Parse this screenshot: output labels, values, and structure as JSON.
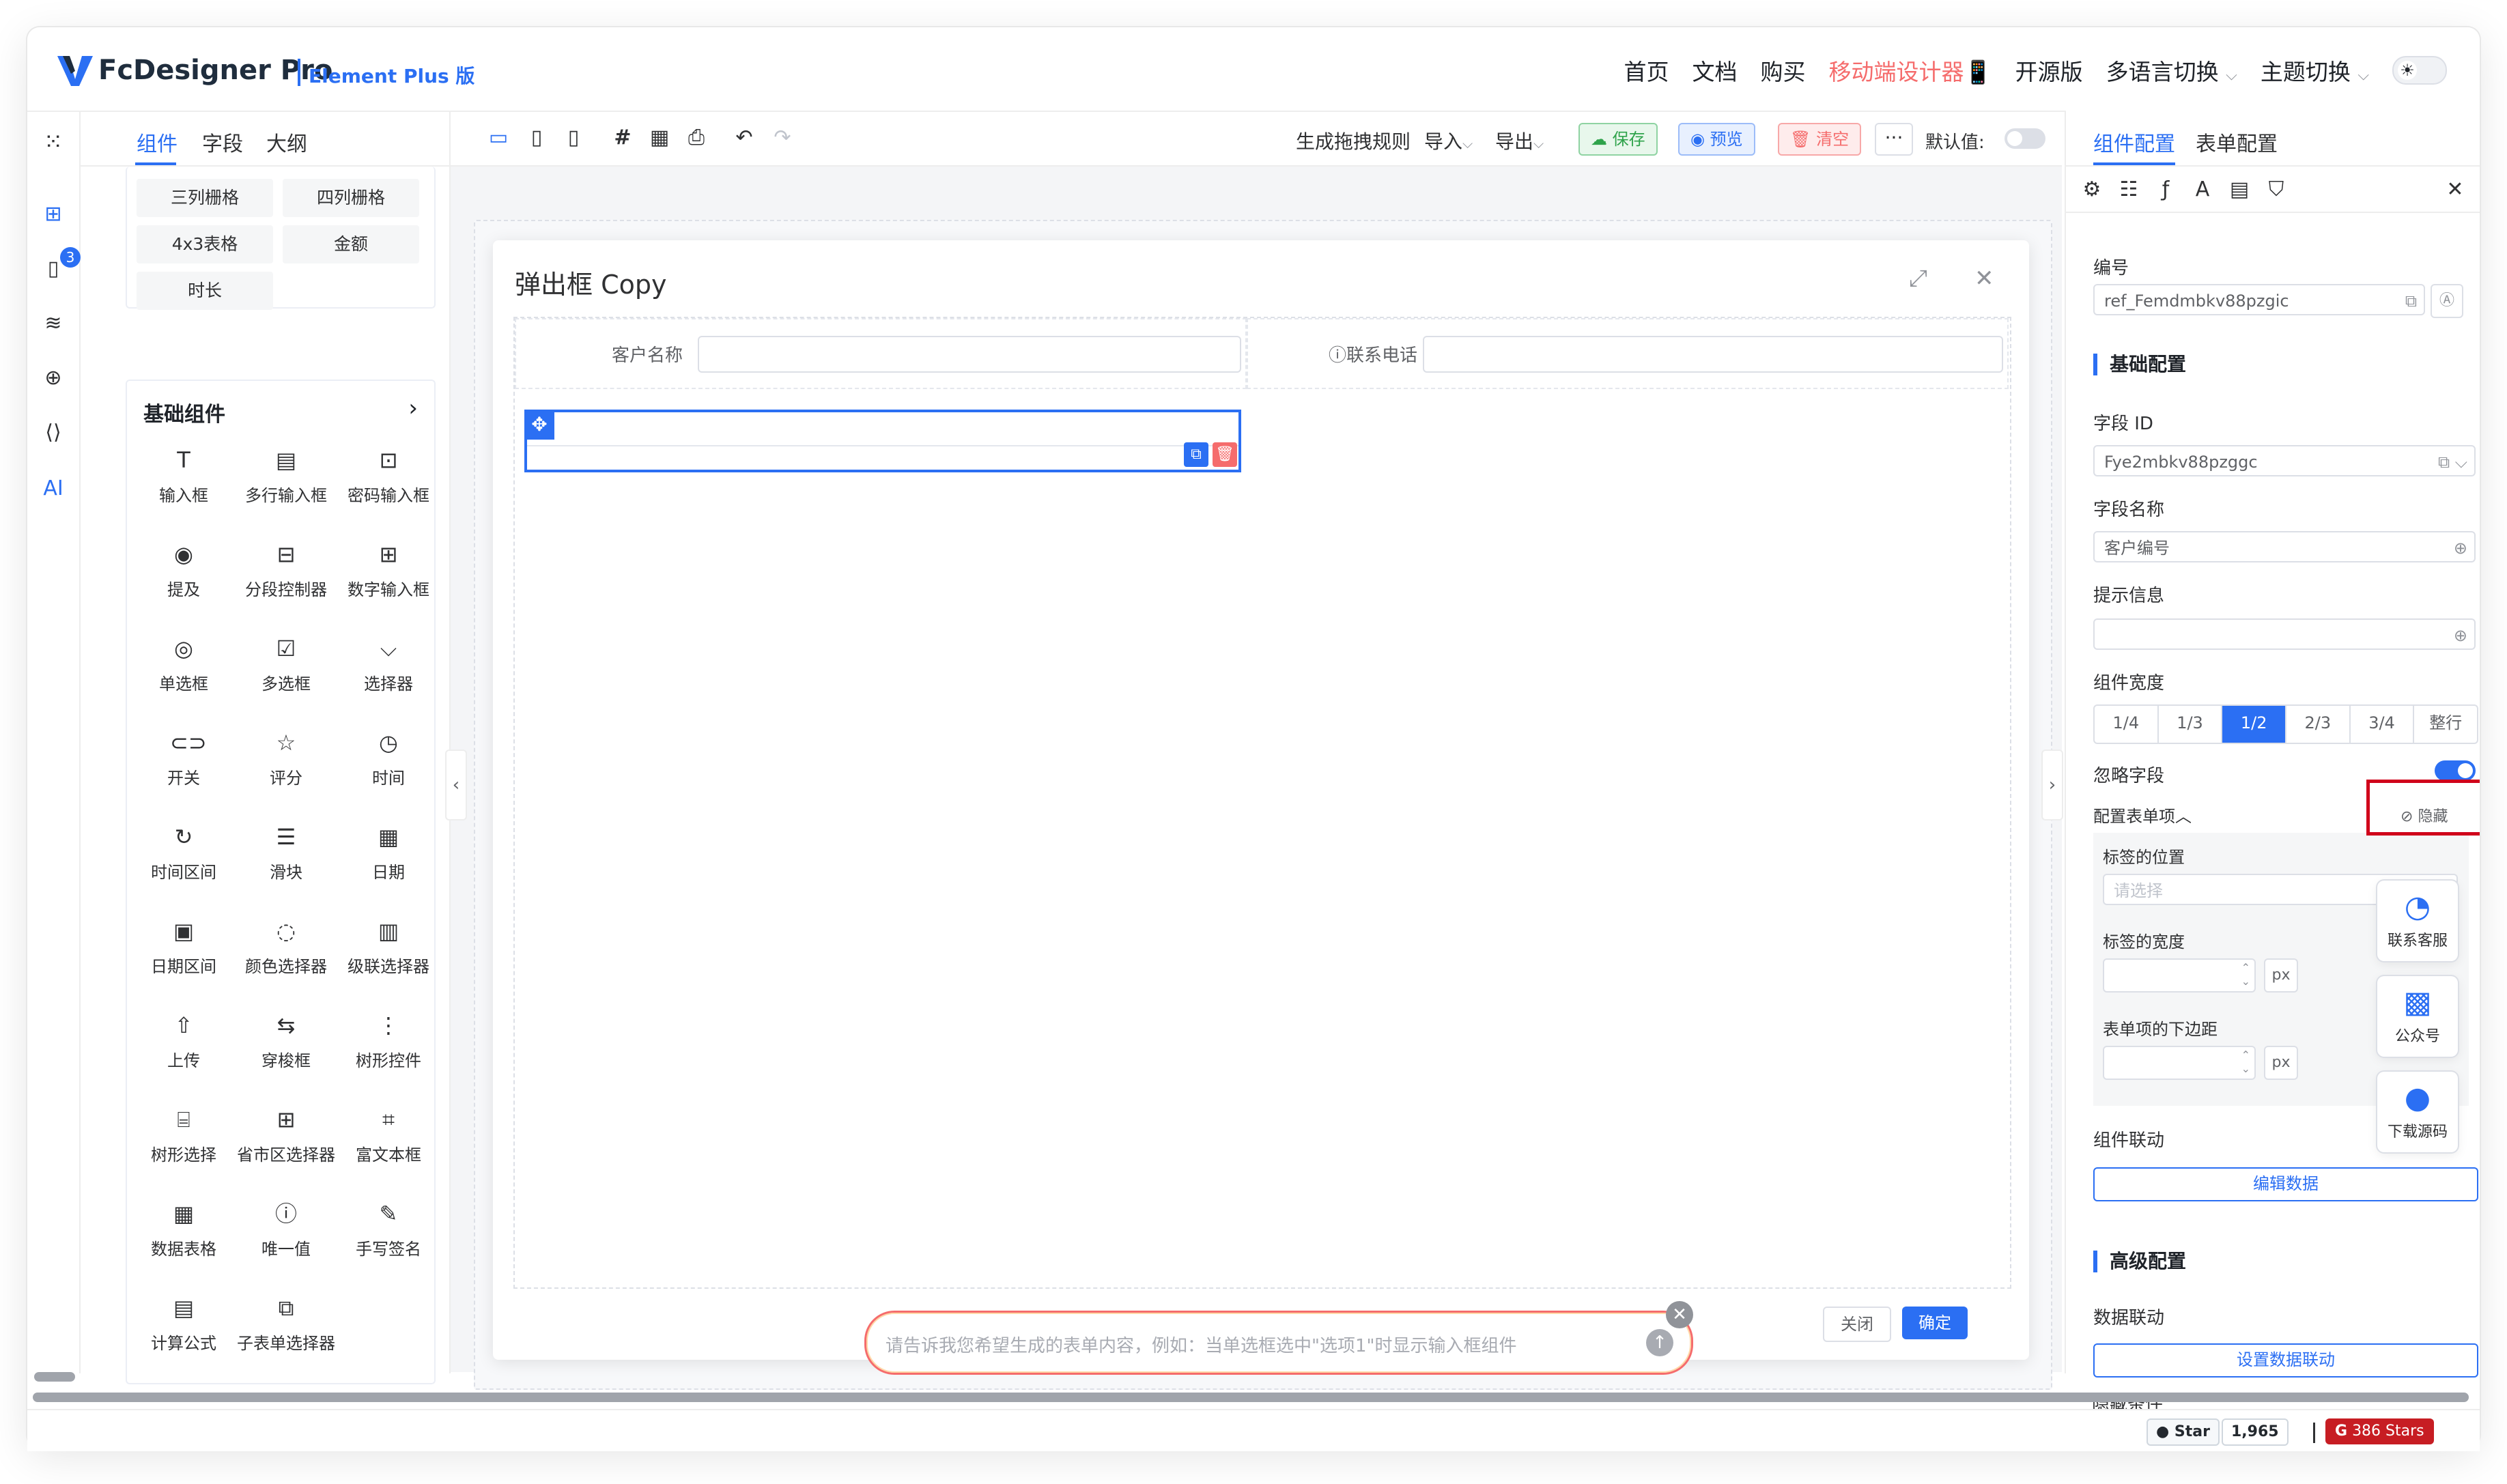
{
  "brand": {
    "name": "FcDesigner Pro",
    "edition": "Element Plus 版"
  },
  "topnav": {
    "home": "首页",
    "docs": "文档",
    "buy": "购买",
    "mobile": "移动端设计器📱",
    "open": "开源版",
    "lang": "多语言切换",
    "theme": "主题切换",
    "theme_icon": "☀"
  },
  "rail": {
    "badge": "3",
    "ai": "AI"
  },
  "left": {
    "tabs": [
      "组件",
      "字段",
      "大纲"
    ],
    "layout_chips": [
      "三列栅格",
      "四列栅格",
      "4x3表格",
      "金额",
      "时长"
    ],
    "group_title": "基础组件",
    "components": [
      {
        "label": "输入框",
        "icon": "T"
      },
      {
        "label": "多行输入框",
        "icon": "▤"
      },
      {
        "label": "密码输入框",
        "icon": "⊡"
      },
      {
        "label": "提及",
        "icon": "◉"
      },
      {
        "label": "分段控制器",
        "icon": "⊟"
      },
      {
        "label": "数字输入框",
        "icon": "⊞"
      },
      {
        "label": "单选框",
        "icon": "◎"
      },
      {
        "label": "多选框",
        "icon": "☑"
      },
      {
        "label": "选择器",
        "icon": "⌵"
      },
      {
        "label": "开关",
        "icon": "⊂⊃"
      },
      {
        "label": "评分",
        "icon": "☆"
      },
      {
        "label": "时间",
        "icon": "◷"
      },
      {
        "label": "时间区间",
        "icon": "↻"
      },
      {
        "label": "滑块",
        "icon": "☰"
      },
      {
        "label": "日期",
        "icon": "▦"
      },
      {
        "label": "日期区间",
        "icon": "▣"
      },
      {
        "label": "颜色选择器",
        "icon": "◌"
      },
      {
        "label": "级联选择器",
        "icon": "▥"
      },
      {
        "label": "上传",
        "icon": "⇧"
      },
      {
        "label": "穿梭框",
        "icon": "⇆"
      },
      {
        "label": "树形控件",
        "icon": "⋮"
      },
      {
        "label": "树形选择",
        "icon": "⌸"
      },
      {
        "label": "省市区选择器",
        "icon": "⊞"
      },
      {
        "label": "富文本框",
        "icon": "⌗"
      },
      {
        "label": "数据表格",
        "icon": "▦"
      },
      {
        "label": "唯一值",
        "icon": "ⓘ"
      },
      {
        "label": "手写签名",
        "icon": "✎"
      },
      {
        "label": "计算公式",
        "icon": "▤"
      },
      {
        "label": "子表单选择器",
        "icon": "⧉"
      }
    ]
  },
  "toolbar": {
    "gen": "生成拖拽规则",
    "import": "导入",
    "export": "导出",
    "save": "保存",
    "preview": "预览",
    "clear": "清空",
    "more": "···",
    "default_label": "默认值:"
  },
  "dialog": {
    "title": "弹出框 Copy",
    "field1_label": "客户名称",
    "field2_label": "ⓘ联系电话",
    "close": "关闭",
    "ok": "确定"
  },
  "ai": {
    "placeholder": "请告诉我您希望生成的表单内容，例如：当单选框选中\"选项1\"时显示输入框组件"
  },
  "right": {
    "tabs": [
      "组件配置",
      "表单配置"
    ],
    "ref_label": "编号",
    "ref_value": "ref_Femdmbkv88pzgic",
    "basic_title": "基础配置",
    "field_id_label": "字段 ID",
    "field_id_value": "Fye2mbkv88pzggc",
    "field_name_label": "字段名称",
    "field_name_value": "客户编号",
    "hint_label": "提示信息",
    "width_label": "组件宽度",
    "width_options": [
      "1/4",
      "1/3",
      "1/2",
      "2/3",
      "3/4",
      "整行"
    ],
    "width_selected": "1/2",
    "ignore_label": "忽略字段",
    "form_item_label": "配置表单项",
    "hide_label": "隐藏",
    "label_pos_label": "标签的位置",
    "label_pos_placeholder": "请选择",
    "label_width_label": "标签的宽度",
    "px": "px",
    "margin_label": "表单项的下边距",
    "linkage_label": "组件联动",
    "edit_data": "编辑数据",
    "adv_title": "高级配置",
    "data_link_label": "数据联动",
    "set_data_link": "设置数据联动",
    "hide_cond_label": "隐藏条件"
  },
  "float": {
    "service": "联系客服",
    "mp": "公众号",
    "download": "下载源码"
  },
  "footer": {
    "star": "Star",
    "star_count": "1,965",
    "gitee": "386 Stars",
    "gitee_logo": "G"
  },
  "colors": {
    "primary": "#2b6ff3",
    "danger": "#f56c6c",
    "success": "#2fa34b"
  }
}
